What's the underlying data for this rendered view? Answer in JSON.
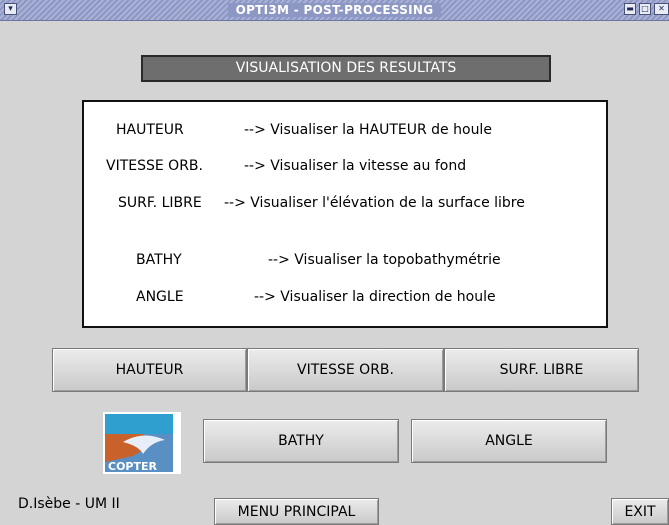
{
  "window": {
    "title": "OPTI3M - POST-PROCESSING",
    "system_menu_icon": "chevron-down-icon",
    "controls": [
      "minimize-icon",
      "maximize-icon",
      "close-icon"
    ]
  },
  "heading": "VISUALISATION DES RESULTATS",
  "legend": {
    "rows": [
      {
        "key": "HAUTEUR",
        "desc": "--> Visualiser la HAUTEUR de houle"
      },
      {
        "key": "VITESSE ORB.",
        "desc": "--> Visualiser la vitesse au fond"
      },
      {
        "key": "SURF. LIBRE",
        "desc": "--> Visualiser l'élévation de la surface libre"
      },
      {
        "key": "BATHY",
        "desc": "--> Visualiser la topobathymétrie"
      },
      {
        "key": "ANGLE",
        "desc": "--> Visualiser la direction de houle"
      }
    ]
  },
  "buttons": {
    "hauteur": "HAUTEUR",
    "vitesse": "VITESSE ORB.",
    "surf": "SURF. LIBRE",
    "bathy": "BATHY",
    "angle": "ANGLE",
    "menu": "MENU PRINCIPAL",
    "exit": "EXIT"
  },
  "logo": {
    "text": "COPTER"
  },
  "footer": {
    "author": "D.Isèbe - UM II"
  },
  "colors": {
    "titlebar": "#8d97c3",
    "heading_bg": "#6e6e6e",
    "background": "#d4d4d4"
  }
}
